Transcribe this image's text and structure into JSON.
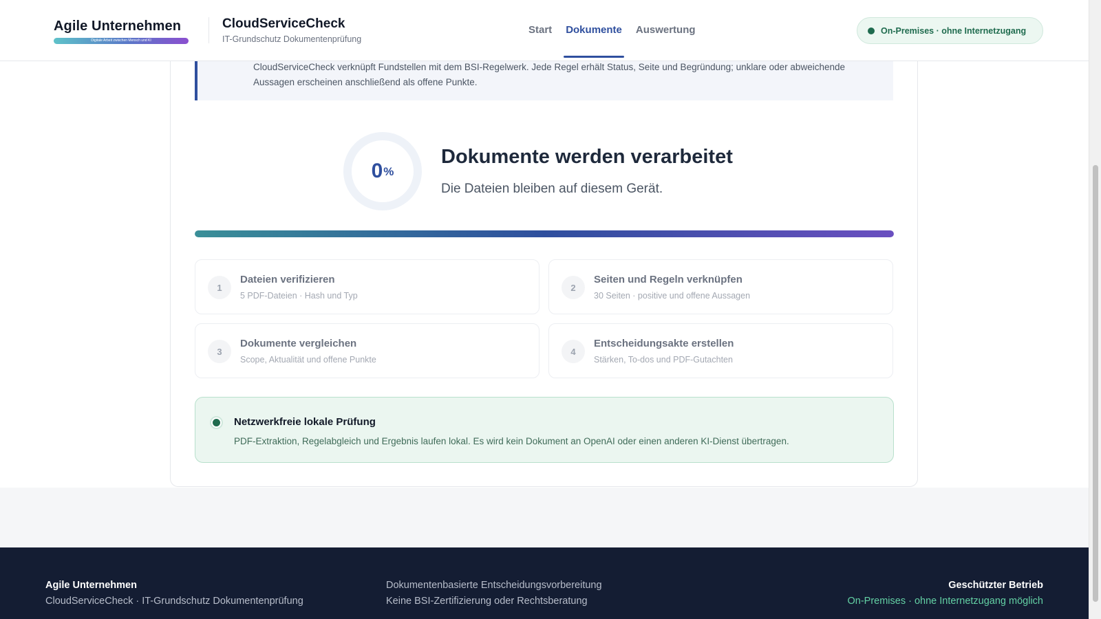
{
  "header": {
    "logo_text": "Agile Unternehmen",
    "logo_tagline": "Digitale Arbeit zwischen Mensch und KI",
    "app_title": "CloudServiceCheck",
    "app_subtitle": "IT-Grundschutz Dokumentenprüfung",
    "nav": [
      {
        "label": "Start",
        "active": false
      },
      {
        "label": "Dokumente",
        "active": true
      },
      {
        "label": "Auswertung",
        "active": false
      }
    ],
    "status_pill": "On-Premises · ohne Internetzugang"
  },
  "info_box": {
    "text": "CloudServiceCheck verknüpft Fundstellen mit dem BSI-Regelwerk. Jede Regel erhält Status, Seite und Begründung; unklare oder abweichende Aussagen erscheinen anschließend als offene Punkte."
  },
  "processing": {
    "percent_value": "0",
    "percent_unit": "%",
    "progress_fraction": 0.0,
    "title": "Dokumente werden verarbeitet",
    "subtitle": "Die Dateien bleiben auf diesem Gerät."
  },
  "steps": [
    {
      "number": "1",
      "title": "Dateien verifizieren",
      "description": "5 PDF-Dateien · Hash und Typ"
    },
    {
      "number": "2",
      "title": "Seiten und Regeln verknüpfen",
      "description": "30 Seiten · positive und offene Aussagen"
    },
    {
      "number": "3",
      "title": "Dokumente vergleichen",
      "description": "Scope, Aktualität und offene Punkte"
    },
    {
      "number": "4",
      "title": "Entscheidungsakte erstellen",
      "description": "Stärken, To-dos und PDF-Gutachten"
    }
  ],
  "notice": {
    "title": "Netzwerkfreie lokale Prüfung",
    "text": "PDF-Extraktion, Regelabgleich und Ergebnis laufen lokal. Es wird kein Dokument an OpenAI oder einen anderen KI-Dienst übertragen."
  },
  "footer": {
    "brand": "Agile Unternehmen",
    "brand_sub": "CloudServiceCheck · IT-Grundschutz Dokumentenprüfung",
    "middle_line1": "Dokumentenbasierte Entscheidungsvorbereitung",
    "middle_line2": "Keine BSI-Zertifizierung oder Rechtsberatung",
    "right_title": "Geschützter Betrieb",
    "right_sub": "On-Premises · ohne Internetzugang möglich"
  },
  "colors": {
    "accent": "#2f4f9e",
    "success": "#1f6b4e",
    "footer_bg": "#141d33"
  }
}
